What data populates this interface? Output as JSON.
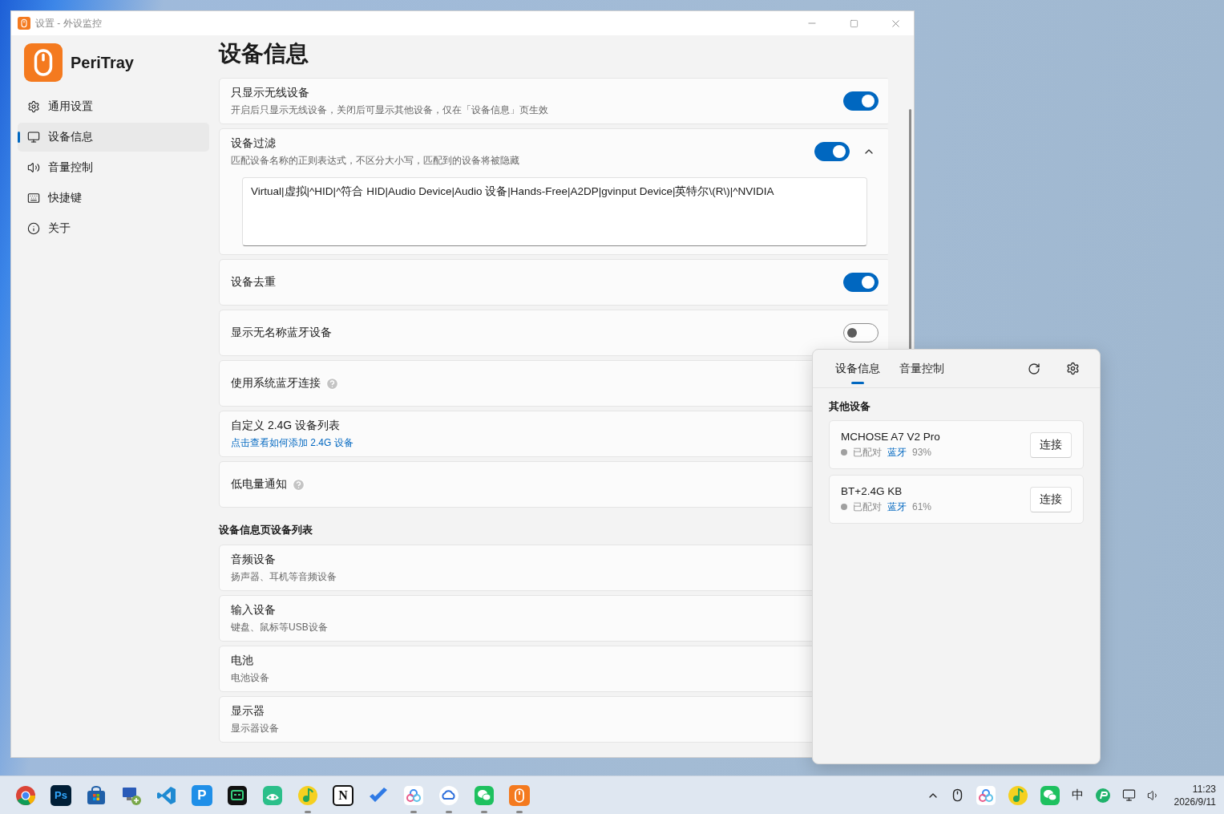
{
  "window": {
    "title": "设置 - 外设监控"
  },
  "sidebar": {
    "app_name": "PeriTray",
    "items": [
      {
        "label": "通用设置",
        "kind": "gear",
        "selected": false
      },
      {
        "label": "设备信息",
        "kind": "monitor",
        "selected": true
      },
      {
        "label": "音量控制",
        "kind": "speaker",
        "selected": false
      },
      {
        "label": "快捷键",
        "kind": "keyboard",
        "selected": false
      },
      {
        "label": "关于",
        "kind": "info",
        "selected": false
      }
    ]
  },
  "page": {
    "title": "设备信息",
    "settings": [
      {
        "kind": "toggle",
        "title": "只显示无线设备",
        "description": "开启后只显示无线设备，关闭后可显示其他设备，仅在「设备信息」页生效",
        "on": true
      },
      {
        "kind": "filter",
        "title": "设备过滤",
        "description": "匹配设备名称的正则表达式，不区分大小写，匹配到的设备将被隐藏",
        "on": true,
        "expanded": true,
        "value": "Virtual|虚拟|^HID|^符合 HID|Audio Device|Audio 设备|Hands-Free|A2DP|gvinput Device|英特尔\\(R\\)|^NVIDIA"
      },
      {
        "kind": "toggle",
        "title": "设备去重",
        "on": true
      },
      {
        "kind": "toggle",
        "title": "显示无名称蓝牙设备",
        "on": false
      },
      {
        "kind": "help",
        "title": "使用系统蓝牙连接"
      },
      {
        "kind": "link",
        "title": "自定义 2.4G 设备列表",
        "link": "点击查看如何添加 2.4G 设备"
      },
      {
        "kind": "help",
        "title": "低电量通知"
      }
    ],
    "section": "设备信息页设备列表",
    "categories": [
      {
        "title": "音频设备",
        "description": "扬声器、耳机等音频设备"
      },
      {
        "title": "输入设备",
        "description": "键盘、鼠标等USB设备"
      },
      {
        "title": "电池",
        "description": "电池设备"
      },
      {
        "title": "显示器",
        "description": "显示器设备"
      }
    ]
  },
  "popup": {
    "tabs": [
      {
        "label": "设备信息",
        "selected": true
      },
      {
        "label": "音量控制",
        "selected": false
      }
    ],
    "section": "其他设备",
    "devices": [
      {
        "name": "MCHOSE A7 V2 Pro",
        "status": "已配对",
        "connection": "蓝牙",
        "battery": "93%",
        "button": "连接"
      },
      {
        "name": "BT+2.4G KB",
        "status": "已配对",
        "connection": "蓝牙",
        "battery": "61%",
        "button": "连接"
      }
    ]
  },
  "taskbar": {
    "apps": [
      {
        "kind": "chrome",
        "running": false
      },
      {
        "kind": "ps",
        "glyph": "Ps",
        "running": false
      },
      {
        "kind": "store",
        "running": false
      },
      {
        "kind": "remote",
        "running": false
      },
      {
        "kind": "vscode",
        "running": false
      },
      {
        "kind": "p",
        "glyph": "P",
        "running": false
      },
      {
        "kind": "terminal",
        "running": false
      },
      {
        "kind": "game",
        "running": false
      },
      {
        "kind": "music",
        "running": true
      },
      {
        "kind": "notion",
        "glyph": "N",
        "running": false
      },
      {
        "kind": "todo",
        "running": false
      },
      {
        "kind": "rings",
        "running": true
      },
      {
        "kind": "cloud",
        "running": true
      },
      {
        "kind": "chat",
        "running": true
      },
      {
        "kind": "mouse",
        "running": true
      }
    ],
    "ime": "中",
    "clock": {
      "time": "11:23",
      "date": "2026/9/11"
    }
  }
}
